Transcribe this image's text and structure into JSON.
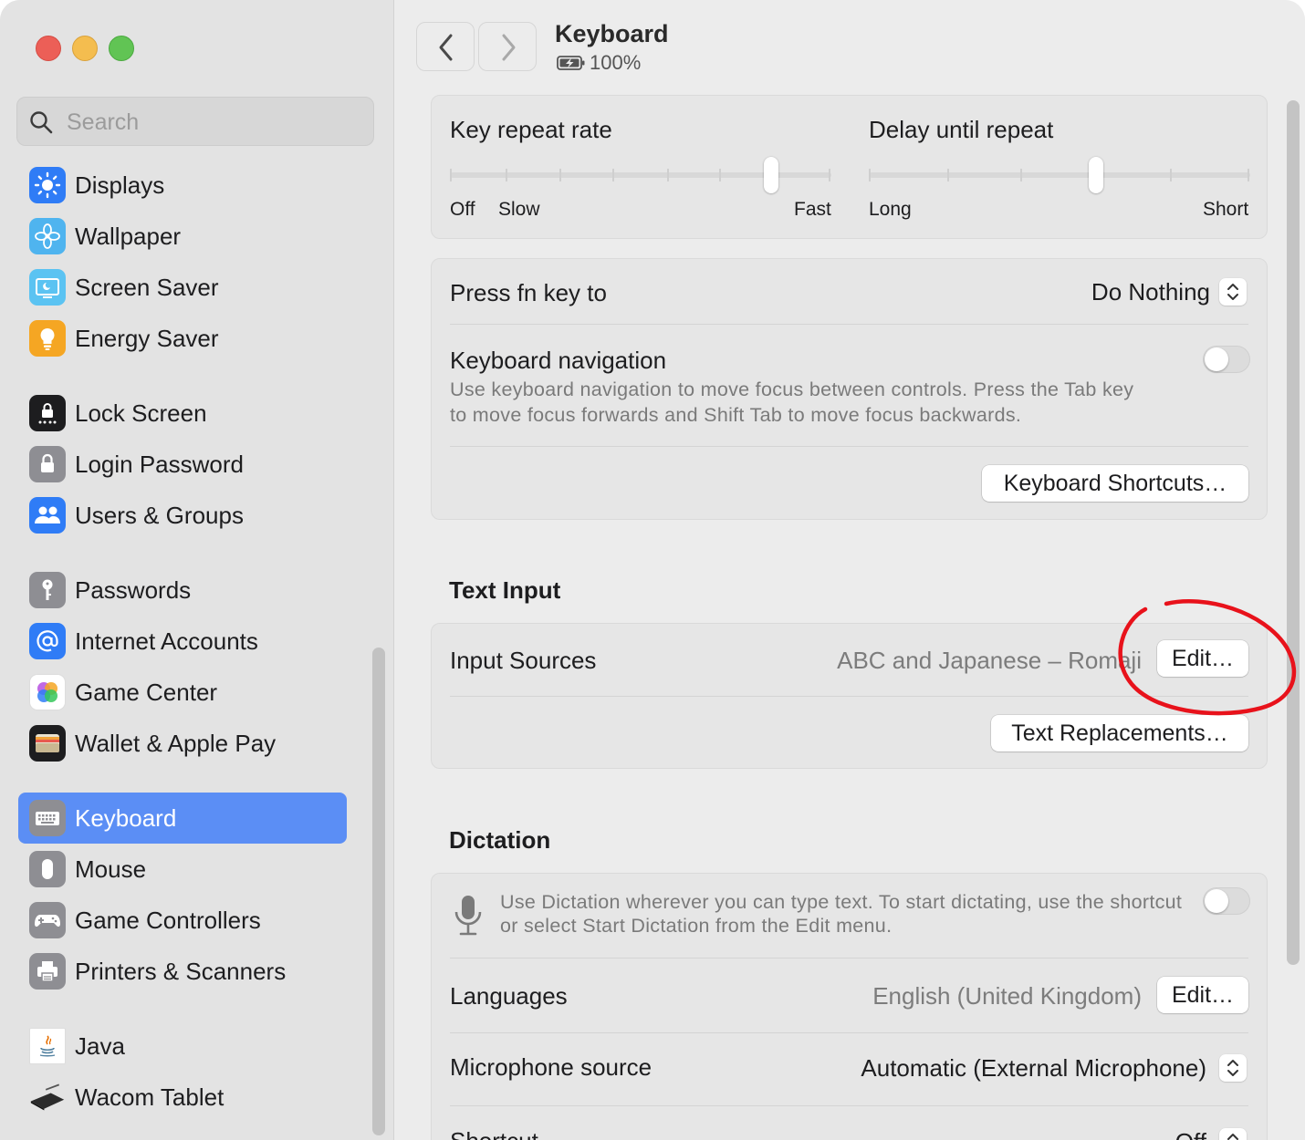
{
  "sidebar": {
    "search_placeholder": "Search",
    "items": [
      {
        "label": "Displays",
        "icon": "sun-icon",
        "color": "#2f7cf6"
      },
      {
        "label": "Wallpaper",
        "icon": "flower-icon",
        "color": "#4fb4ef"
      },
      {
        "label": "Screen Saver",
        "icon": "screensaver-icon",
        "color": "#5bc3f2"
      },
      {
        "label": "Energy Saver",
        "icon": "bulb-icon",
        "color": "#f5a623"
      },
      {
        "label": "Lock Screen",
        "icon": "lock-screen-icon",
        "color": "#1d1d1f"
      },
      {
        "label": "Login Password",
        "icon": "padlock-icon",
        "color": "#8e8e93"
      },
      {
        "label": "Users & Groups",
        "icon": "users-icon",
        "color": "#2f7cf6"
      },
      {
        "label": "Passwords",
        "icon": "key-icon",
        "color": "#8e8e93"
      },
      {
        "label": "Internet Accounts",
        "icon": "at-icon",
        "color": "#2f7cf6"
      },
      {
        "label": "Game Center",
        "icon": "game-center-icon",
        "color": "#ffffff"
      },
      {
        "label": "Wallet & Apple Pay",
        "icon": "wallet-icon",
        "color": "#1d1d1f"
      },
      {
        "label": "Keyboard",
        "icon": "keyboard-icon",
        "color": "#8e8e93"
      },
      {
        "label": "Mouse",
        "icon": "mouse-icon",
        "color": "#8e8e93"
      },
      {
        "label": "Game Controllers",
        "icon": "gamepad-icon",
        "color": "#8e8e93"
      },
      {
        "label": "Printers & Scanners",
        "icon": "printer-icon",
        "color": "#8e8e93"
      },
      {
        "label": "Java",
        "icon": "java-icon",
        "color": "#ffffff"
      },
      {
        "label": "Wacom Tablet",
        "icon": "tablet-icon",
        "color": "#333333"
      }
    ],
    "active": "Keyboard",
    "active_color": "#5b8ef5"
  },
  "header": {
    "title": "Keyboard",
    "battery": "100%"
  },
  "repeat": {
    "key_repeat_label": "Key repeat rate",
    "key_repeat_off": "Off",
    "key_repeat_slow": "Slow",
    "key_repeat_fast": "Fast",
    "key_repeat_position": "7 of 8",
    "delay_label": "Delay until repeat",
    "delay_long": "Long",
    "delay_short": "Short",
    "delay_position": "4 of 6"
  },
  "fn": {
    "press_fn_label": "Press fn key to",
    "press_fn_value": "Do Nothing",
    "nav_label": "Keyboard navigation",
    "nav_desc_1": "Use keyboard navigation to move focus between controls. Press the Tab key",
    "nav_desc_2": "to move focus forwards and Shift Tab to move focus backwards.",
    "nav_enabled": false,
    "shortcuts_button": "Keyboard Shortcuts…"
  },
  "text_input": {
    "section_title": "Text Input",
    "input_sources_label": "Input Sources",
    "input_sources_value": "ABC and Japanese – Romaji",
    "edit_button": "Edit…",
    "text_replacements_button": "Text Replacements…"
  },
  "dictation": {
    "section_title": "Dictation",
    "desc_1": "Use Dictation wherever you can type text. To start dictating, use the shortcut",
    "desc_2": "or select Start Dictation from the Edit menu.",
    "enabled": false,
    "languages_label": "Languages",
    "languages_value": "English (United Kingdom)",
    "languages_edit": "Edit…",
    "mic_label": "Microphone source",
    "mic_value": "Automatic (External Microphone)",
    "shortcut_label": "Shortcut",
    "shortcut_value": "Off"
  },
  "annotation_color": "#e8121b"
}
